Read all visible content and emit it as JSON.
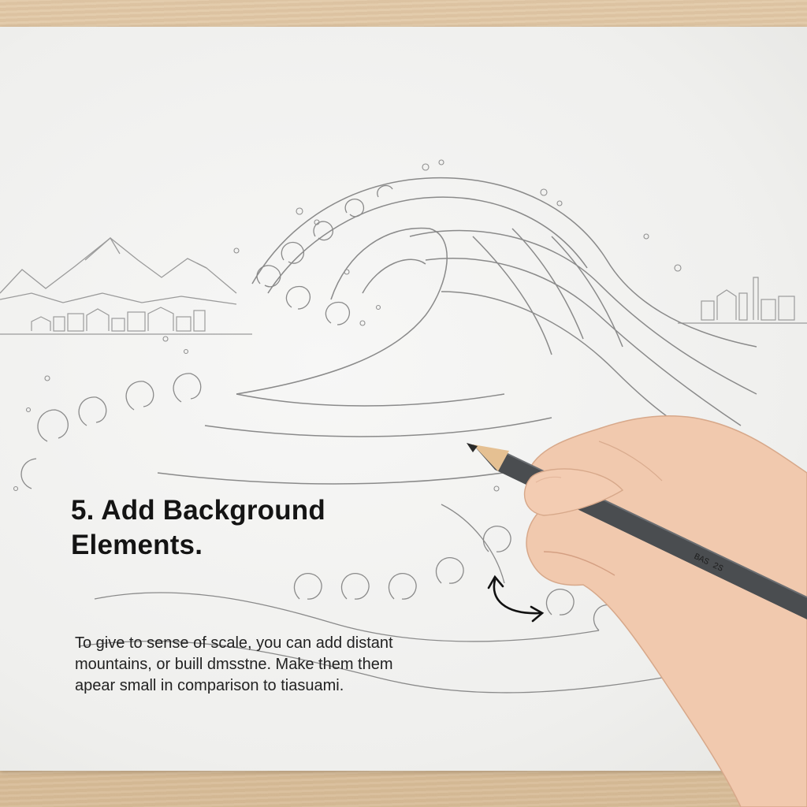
{
  "heading": "5. Add Background Elements.",
  "body": "To give to sense of scale, you can add distant mountains, or buill dmsstne. Make them them apear small in comparison to tiasuami.",
  "pencil_marking": "BAS 2S",
  "colors": {
    "desk": "#dcc3a2",
    "paper": "#f2f2f0",
    "sketch_line": "#8a8a8a",
    "text": "#141414",
    "pencil": "#4a4d50",
    "skin": "#f1c9ae"
  }
}
